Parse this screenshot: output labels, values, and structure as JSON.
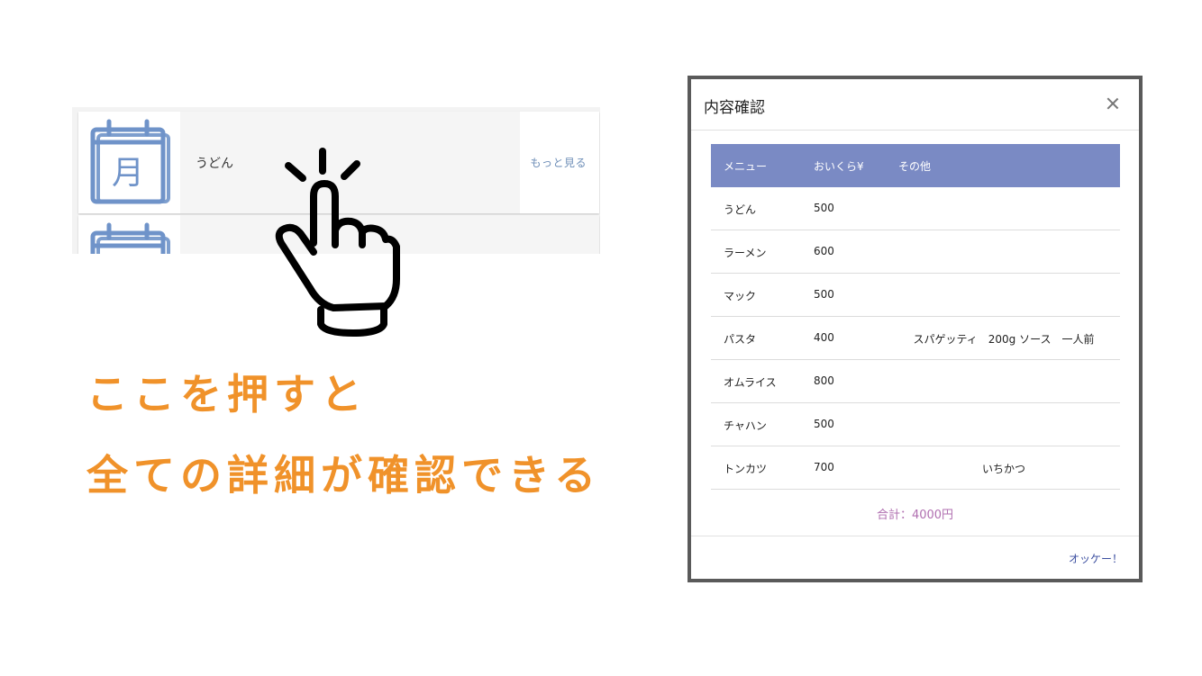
{
  "list": {
    "items": [
      {
        "title": "うどん",
        "more_label": "もっと見る",
        "icon": "calendar-icon"
      },
      {
        "title": "",
        "more_label": "",
        "icon": "calendar-icon"
      }
    ],
    "calendar_glyph": "月"
  },
  "hand_icon": "pointing-hand-icon",
  "caption": {
    "line1": "ここを押すと",
    "line2": "全ての詳細が確認できる"
  },
  "modal": {
    "title": "内容確認",
    "close_icon": "close-icon",
    "columns": [
      "メニュー",
      "おいくら¥",
      "その他"
    ],
    "rows": [
      {
        "name": "うどん",
        "price": "500",
        "other": ""
      },
      {
        "name": "ラーメン",
        "price": "600",
        "other": ""
      },
      {
        "name": "マック",
        "price": "500",
        "other": ""
      },
      {
        "name": "パスタ",
        "price": "400",
        "other": "スパゲッティ　200g ソース　一人前"
      },
      {
        "name": "オムライス",
        "price": "800",
        "other": ""
      },
      {
        "name": "チャハン",
        "price": "500",
        "other": ""
      },
      {
        "name": "トンカツ",
        "price": "700",
        "other": "いちかつ"
      }
    ],
    "total": "合計：4000円",
    "ok_label": "オッケー！"
  },
  "colors": {
    "header_bg": "#7a8ac4",
    "caption": "#f0922a",
    "total": "#b06fb0",
    "calendar": "#6f93c9"
  }
}
